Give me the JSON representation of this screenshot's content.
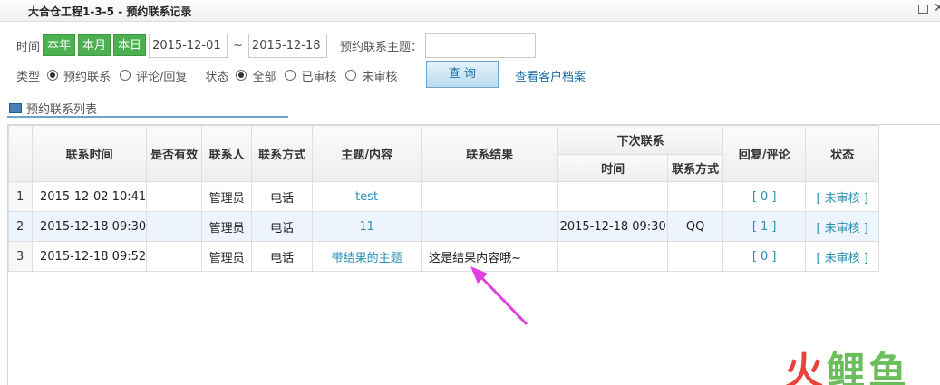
{
  "window": {
    "title": "大合仓工程1-3-5 - 预约联系记录"
  },
  "filters": {
    "time_label": "时间",
    "year_btn": "本年",
    "month_btn": "本月",
    "day_btn": "本日",
    "date_from": "2015-12-01",
    "tilde": "~",
    "date_to": "2015-12-18",
    "topic_label": "预约联系主题：",
    "topic_value": "",
    "type_label": "类型",
    "type_opt1": "预约联系",
    "type_opt2": "评论/回复",
    "status_label": "状态",
    "status_opt1": "全部",
    "status_opt2": "已审核",
    "status_opt3": "未审核",
    "query_btn": "查 询",
    "archive_link": "查看客户档案"
  },
  "section": {
    "title": "预约联系列表"
  },
  "table": {
    "headers": {
      "contact_time": "联系时间",
      "valid": "是否有效",
      "contact_person": "联系人",
      "contact_method": "联系方式",
      "topic": "主题/内容",
      "result": "联系结果",
      "next_contact": "下次联系",
      "next_time": "时间",
      "next_method": "联系方式",
      "reply": "回复/评论",
      "status": "状态"
    },
    "rows": [
      {
        "no": "1",
        "time": "2015-12-02 10:41",
        "valid": "",
        "person": "管理员",
        "method": "电话",
        "topic": "test",
        "result": "",
        "next_time": "",
        "next_method": "",
        "reply": "[ 0 ]",
        "status": "[ 未审核 ]"
      },
      {
        "no": "2",
        "time": "2015-12-18 09:30",
        "valid": "",
        "person": "管理员",
        "method": "电话",
        "topic": "11",
        "result": "",
        "next_time": "2015-12-18 09:30",
        "next_method": "QQ",
        "reply": "[ 1 ]",
        "status": "[ 未审核 ]"
      },
      {
        "no": "3",
        "time": "2015-12-18 09:52",
        "valid": "",
        "person": "管理员",
        "method": "电话",
        "topic": "带结果的主题",
        "result": "这是结果内容哦~",
        "next_time": "",
        "next_method": "",
        "reply": "[ 0 ]",
        "status": "[ 未审核 ]"
      }
    ]
  },
  "colors": {
    "accent_green": "#4caf50",
    "link_blue": "#2a8fb5",
    "arrow_magenta": "#e040e0"
  },
  "watermark": {
    "text1": "火",
    "text2": "鲤",
    "text3": "鱼"
  }
}
